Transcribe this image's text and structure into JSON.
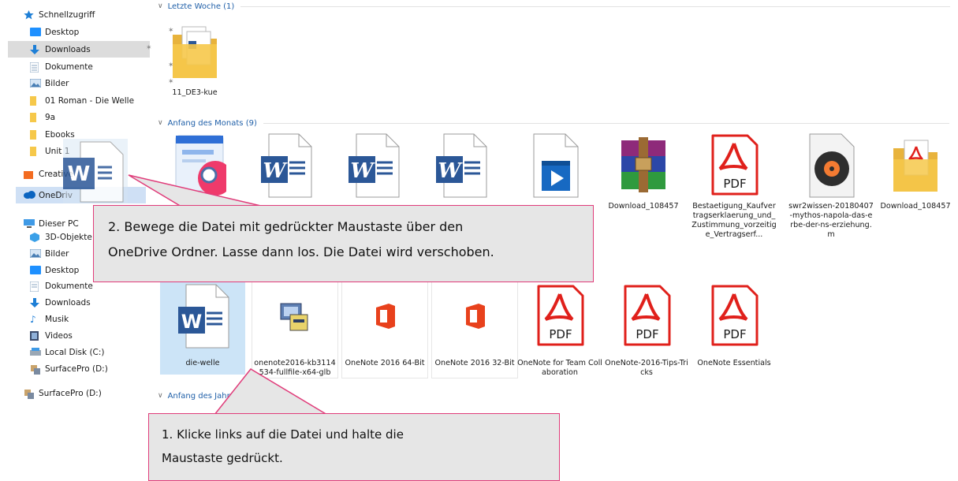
{
  "sidebar": {
    "quick_access": "Schnellzugriff",
    "quick_items": [
      {
        "label": "Desktop",
        "pinned": true
      },
      {
        "label": "Downloads",
        "pinned": true
      },
      {
        "label": "Dokumente",
        "pinned": true
      },
      {
        "label": "Bilder",
        "pinned": true
      },
      {
        "label": "01 Roman - Die Welle"
      },
      {
        "label": "9a"
      },
      {
        "label": "Ebooks"
      },
      {
        "label": "Unit 1"
      }
    ],
    "creative": "Creative",
    "onedrive": "OneDriv",
    "this_pc": "Dieser PC",
    "pc_items": [
      "3D-Objekte",
      "Bilder",
      "Desktop",
      "Dokumente",
      "Downloads",
      "Musik",
      "Videos",
      "Local Disk (C:)",
      "SurfacePro (D:)"
    ],
    "network": "SurfacePro (D:)",
    "pin_glyph": "📌"
  },
  "groups": {
    "last_week": "Letzte Woche (1)",
    "month_start": "Anfang des Monats (9)",
    "year_start": "Anfang des Jahr"
  },
  "files": {
    "last_week": [
      {
        "name": "11_DE3-kue",
        "icon": "folder-doc-icon"
      }
    ],
    "month_row1": [
      {
        "name": "",
        "icon": "image-viewer-icon"
      },
      {
        "name": "",
        "icon": "word-doc-icon"
      },
      {
        "name": "",
        "icon": "word-doc-icon"
      },
      {
        "name": "",
        "icon": "word-doc-icon"
      },
      {
        "name": "",
        "icon": "video-file-icon"
      },
      {
        "name": "Download_108457",
        "icon": "winrar-icon"
      },
      {
        "name": "Bestaetigung_Kaufvertragserklaerung_und_Zustimmung_vorzeitige_Vertragserf...",
        "icon": "pdf-icon"
      },
      {
        "name": "swr2wissen-20180407-mythos-napola-das-erbe-der-ns-erziehung.m",
        "icon": "audio-disc-icon"
      },
      {
        "name": "Download_108457",
        "icon": "folder-pdf-icon"
      }
    ],
    "month_row2": [
      {
        "name": "die-welle",
        "icon": "word-doc-icon"
      },
      {
        "name": "onenote2016-kb3114534-fullfile-x64-glb",
        "icon": "installer-icon"
      },
      {
        "name": "OneNote 2016 64-Bit",
        "icon": "office-icon"
      },
      {
        "name": "OneNote 2016 32-Bit",
        "icon": "office-icon"
      },
      {
        "name": "OneNote for Team Collaboration",
        "icon": "pdf-icon"
      },
      {
        "name": "OneNote-2016-Tips-Tricks",
        "icon": "pdf-icon"
      },
      {
        "name": "OneNote Essentials",
        "icon": "pdf-icon"
      }
    ]
  },
  "drag_ghost": {
    "icon": "word-doc-icon",
    "letter": "W"
  },
  "pdf_label": "PDF",
  "callouts": {
    "step2_line1": "2. Bewege die Datei mit gedrückter Maustaste über den",
    "step2_line2": "OneDrive Ordner. Lasse dann los. Die Datei wird verschoben.",
    "step1_line1": "1. Klicke links auf die Datei und halte die",
    "step1_line2": "Maustaste gedrückt."
  },
  "colors": {
    "accent": "#e03c7a",
    "selection": "#cce4f7",
    "word": "#2b5797",
    "pdf": "#e0201b",
    "folder": "#f6c84a"
  }
}
